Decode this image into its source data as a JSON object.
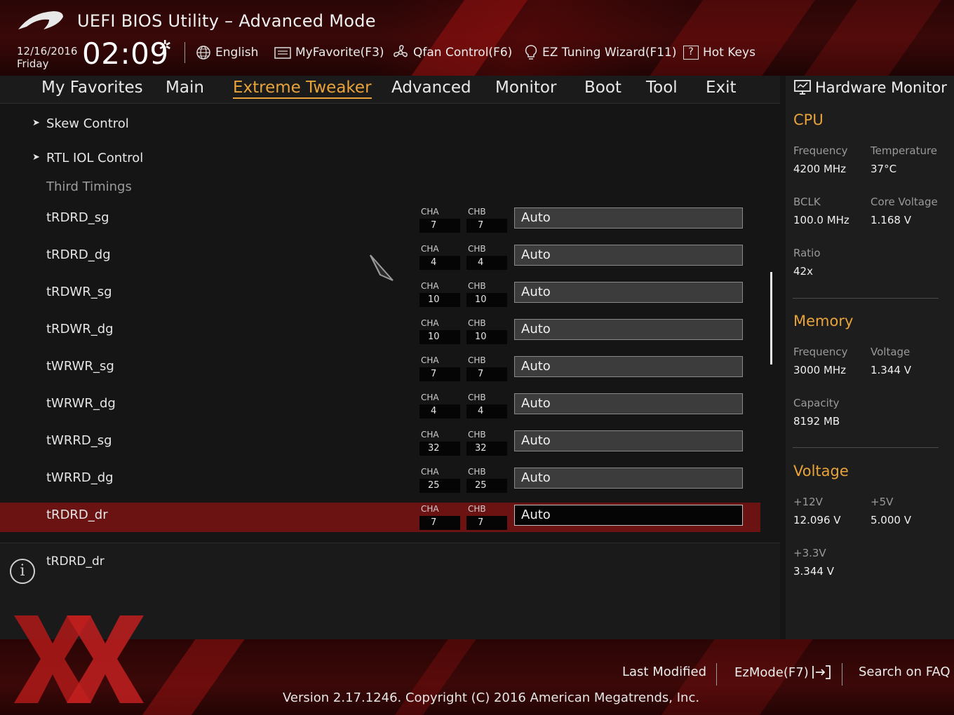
{
  "header": {
    "title": "UEFI BIOS Utility – Advanced Mode",
    "date": "12/16/2016",
    "day": "Friday",
    "time": "02:09",
    "tools": [
      {
        "label": "English",
        "icon": "globe-icon"
      },
      {
        "label": "MyFavorite(F3)",
        "icon": "favorite-list-icon"
      },
      {
        "label": "Qfan Control(F6)",
        "icon": "fan-icon"
      },
      {
        "label": "EZ Tuning Wizard(F11)",
        "icon": "lightbulb-icon"
      },
      {
        "label": "Hot Keys",
        "icon": "question-box-icon"
      }
    ]
  },
  "nav": {
    "tabs": [
      "My Favorites",
      "Main",
      "Extreme Tweaker",
      "Advanced",
      "Monitor",
      "Boot",
      "Tool",
      "Exit"
    ],
    "active": "Extreme Tweaker"
  },
  "menu": {
    "submenus": [
      "Skew Control",
      "RTL IOL Control"
    ],
    "section": "Third Timings",
    "cha_label": "CHA",
    "chb_label": "CHB",
    "rows": [
      {
        "name": "tRDRD_sg",
        "cha": "7",
        "chb": "7",
        "value": "Auto"
      },
      {
        "name": "tRDRD_dg",
        "cha": "4",
        "chb": "4",
        "value": "Auto"
      },
      {
        "name": "tRDWR_sg",
        "cha": "10",
        "chb": "10",
        "value": "Auto"
      },
      {
        "name": "tRDWR_dg",
        "cha": "10",
        "chb": "10",
        "value": "Auto"
      },
      {
        "name": "tWRWR_sg",
        "cha": "7",
        "chb": "7",
        "value": "Auto"
      },
      {
        "name": "tWRWR_dg",
        "cha": "4",
        "chb": "4",
        "value": "Auto"
      },
      {
        "name": "tWRRD_sg",
        "cha": "32",
        "chb": "32",
        "value": "Auto"
      },
      {
        "name": "tWRRD_dg",
        "cha": "25",
        "chb": "25",
        "value": "Auto"
      },
      {
        "name": "tRDRD_dr",
        "cha": "7",
        "chb": "7",
        "value": "Auto"
      }
    ],
    "selected": "tRDRD_dr"
  },
  "info": {
    "text": "tRDRD_dr"
  },
  "hw_monitor": {
    "title": "Hardware Monitor",
    "cpu": {
      "heading": "CPU",
      "frequency_label": "Frequency",
      "frequency": "4200 MHz",
      "temperature_label": "Temperature",
      "temperature": "37°C",
      "bclk_label": "BCLK",
      "bclk": "100.0 MHz",
      "core_voltage_label": "Core Voltage",
      "core_voltage": "1.168 V",
      "ratio_label": "Ratio",
      "ratio": "42x"
    },
    "memory": {
      "heading": "Memory",
      "frequency_label": "Frequency",
      "frequency": "3000 MHz",
      "voltage_label": "Voltage",
      "voltage": "1.344 V",
      "capacity_label": "Capacity",
      "capacity": "8192 MB"
    },
    "voltage": {
      "heading": "Voltage",
      "v12_label": "+12V",
      "v12": "12.096 V",
      "v5_label": "+5V",
      "v5": "5.000 V",
      "v33_label": "+3.3V",
      "v33": "3.344 V"
    }
  },
  "footer": {
    "last_modified": "Last Modified",
    "ezmode": "EzMode(F7)",
    "search_faq": "Search on FAQ",
    "version": "Version 2.17.1246. Copyright (C) 2016 American Megatrends, Inc."
  },
  "colors": {
    "accent": "#e8a33a",
    "selected_row": "#6b1212",
    "header_red": "#3a0808"
  }
}
